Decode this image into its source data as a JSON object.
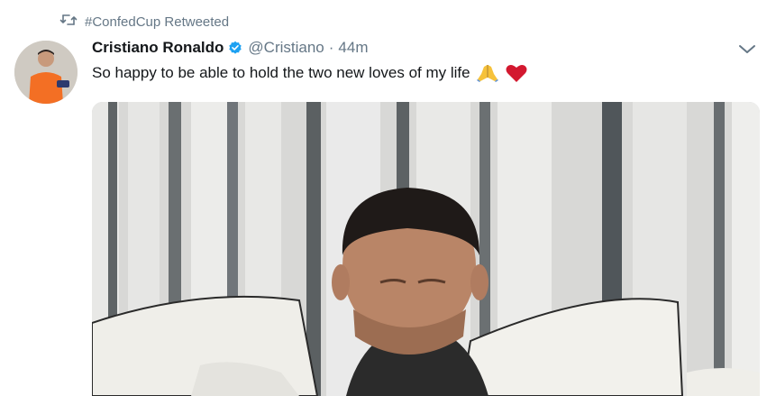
{
  "retweet": {
    "icon": "retweet-icon",
    "text": "#ConfedCup Retweeted"
  },
  "author": {
    "name": "Cristiano Ronaldo",
    "verified_icon": "verified-badge-icon",
    "handle": "@Cristiano",
    "separator": "·",
    "time": "44m"
  },
  "tweet": {
    "text": "So happy to be able to hold the two new loves of my life",
    "emojis": [
      "folded-hands-emoji",
      "red-heart-emoji"
    ]
  },
  "menu": {
    "icon": "chevron-down-icon"
  },
  "media": {
    "description_icon": "photo"
  },
  "colors": {
    "verified": "#1da1f2",
    "muted": "#657786",
    "heart": "#d3182f"
  }
}
